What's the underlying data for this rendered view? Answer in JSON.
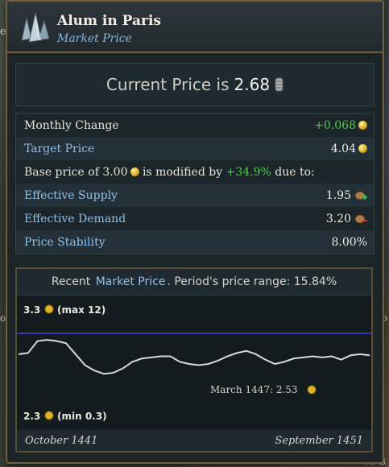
{
  "header": {
    "title": "Alum in Paris",
    "subtitle": "Market Price"
  },
  "current": {
    "prefix": "Current Price is",
    "value": "2.68"
  },
  "stats": {
    "monthly_change_label": "Monthly Change",
    "monthly_change_value": "+0.068",
    "target_price_label": "Target Price",
    "target_price_value": "4.04",
    "base_text_1": "Base price of 3.00",
    "base_text_2": "is modified by",
    "base_mod": "+34.9%",
    "base_text_3": "due to:",
    "supply_label": "Effective Supply",
    "supply_value": "1.95",
    "demand_label": "Effective Demand",
    "demand_value": "3.20",
    "stability_label": "Price Stability",
    "stability_value": "8.00%"
  },
  "chart_head": {
    "pre": "Recent",
    "link": "Market Price",
    "post": ". Period's price range:",
    "range": "15.84%"
  },
  "chart_data": {
    "type": "line",
    "x_start": "October 1441",
    "x_end": "September 1451",
    "y_top_label": "3.3",
    "y_top_note": "(max 12)",
    "y_bottom_label": "2.3",
    "y_bottom_note": "(min 0.3)",
    "ylim": [
      2.3,
      3.3
    ],
    "target_line": 3.05,
    "annotation": "March 1447: 2.53",
    "series": [
      {
        "values": [
          2.86,
          2.87,
          2.98,
          2.99,
          2.98,
          2.96,
          2.86,
          2.76,
          2.71,
          2.68,
          2.69,
          2.73,
          2.79,
          2.82,
          2.83,
          2.84,
          2.84,
          2.79,
          2.77,
          2.76,
          2.77,
          2.8,
          2.84,
          2.87,
          2.89,
          2.86,
          2.81,
          2.77,
          2.79,
          2.82,
          2.83,
          2.84,
          2.83,
          2.84,
          2.81,
          2.85,
          2.86,
          2.85
        ]
      }
    ]
  },
  "colors": {
    "accent_blue": "#8fc2ea",
    "positive": "#4ccb4c",
    "target_line": "#3f3fd8",
    "price_line": "#d9d9d9"
  },
  "background": {
    "left_top": "e",
    "left_mid": "o",
    "right_mid": "oo",
    "bottom_right": "Ai-B"
  }
}
